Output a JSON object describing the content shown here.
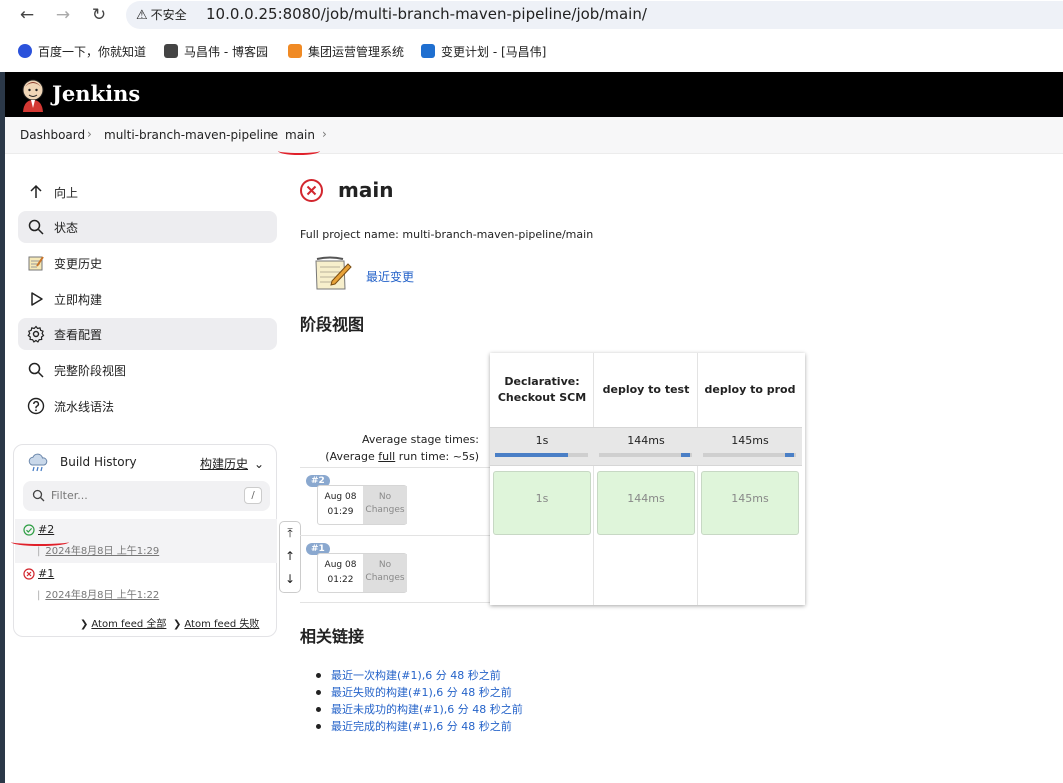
{
  "browser": {
    "insecure_label": "不安全",
    "url": "10.0.0.25:8080/job/multi-branch-maven-pipeline/job/main/",
    "bookmarks": [
      {
        "label": "百度一下，你就知道",
        "icon": "baidu-paw-icon",
        "color": "#2b52db"
      },
      {
        "label": "马昌伟 - 博客园",
        "icon": "cnblogs-icon",
        "color": "#444444"
      },
      {
        "label": "集团运营管理系统",
        "icon": "ops-system-icon",
        "color": "#f08a24"
      },
      {
        "label": "变更计划 - [马昌伟]",
        "icon": "confluence-icon",
        "color": "#1f6fd0"
      }
    ]
  },
  "header": {
    "title": "Jenkins",
    "logo": "jenkins-butler-logo"
  },
  "breadcrumb": {
    "items": [
      "Dashboard",
      "multi-branch-maven-pipeline",
      "main"
    ]
  },
  "sidebar": {
    "tasks": [
      {
        "label": "向上",
        "icon": "arrow-up-icon",
        "active": false
      },
      {
        "label": "状态",
        "icon": "search-icon",
        "active": true
      },
      {
        "label": "变更历史",
        "icon": "notepad-icon",
        "active": false
      },
      {
        "label": "立即构建",
        "icon": "play-icon",
        "active": false
      },
      {
        "label": "查看配置",
        "icon": "gear-icon",
        "active": true
      },
      {
        "label": "完整阶段视图",
        "icon": "search-icon",
        "active": false
      },
      {
        "label": "流水线语法",
        "icon": "help-icon",
        "active": false
      }
    ]
  },
  "build_history": {
    "title": "Build History",
    "trend_link": "构建历史",
    "filter_placeholder": "Filter...",
    "filter_shortcut": "/",
    "builds": [
      {
        "number": "#2",
        "date": "2024年8月8日 上午1:29",
        "status": "success"
      },
      {
        "number": "#1",
        "date": "2024年8月8日 上午1:22",
        "status": "failed"
      }
    ],
    "atom_all": "Atom feed 全部",
    "atom_failed": "Atom feed 失败"
  },
  "main": {
    "title": "main",
    "status": "failed",
    "full_name": "Full project name: multi-branch-maven-pipeline/main",
    "recent_changes": "最近变更",
    "stage_view_title": "阶段视图",
    "related_links_title": "相关链接"
  },
  "stage_view": {
    "avg_label_1": "Average stage times:",
    "avg_label_2_pre": "(Average ",
    "avg_label_2_link": "full",
    "avg_label_2_post": " run time: ~5s)",
    "stages": [
      {
        "name": "Declarative: Checkout SCM",
        "avg": "1s",
        "avg_fraction": 0.78
      },
      {
        "name": "deploy to test",
        "avg": "144ms",
        "avg_fraction": 0.1
      },
      {
        "name": "deploy to prod",
        "avg": "145ms",
        "avg_fraction": 0.1
      }
    ],
    "runs": [
      {
        "badge": "#2",
        "month_day": "Aug 08",
        "time": "01:29",
        "changes": "No Changes",
        "cells": [
          "1s",
          "144ms",
          "145ms"
        ]
      },
      {
        "badge": "#1",
        "month_day": "Aug 08",
        "time": "01:22",
        "changes": "No Changes",
        "cells": []
      }
    ]
  },
  "related_links": [
    "最近一次构建(#1),6 分 48 秒之前",
    "最近失败的构建(#1),6 分 48 秒之前",
    "最近未成功的构建(#1),6 分 48 秒之前",
    "最近完成的构建(#1),6 分 48 秒之前"
  ],
  "colors": {
    "success": "#2e9e44",
    "failed": "#d2262e",
    "link": "#2563c9",
    "header_bg": "#000000"
  }
}
